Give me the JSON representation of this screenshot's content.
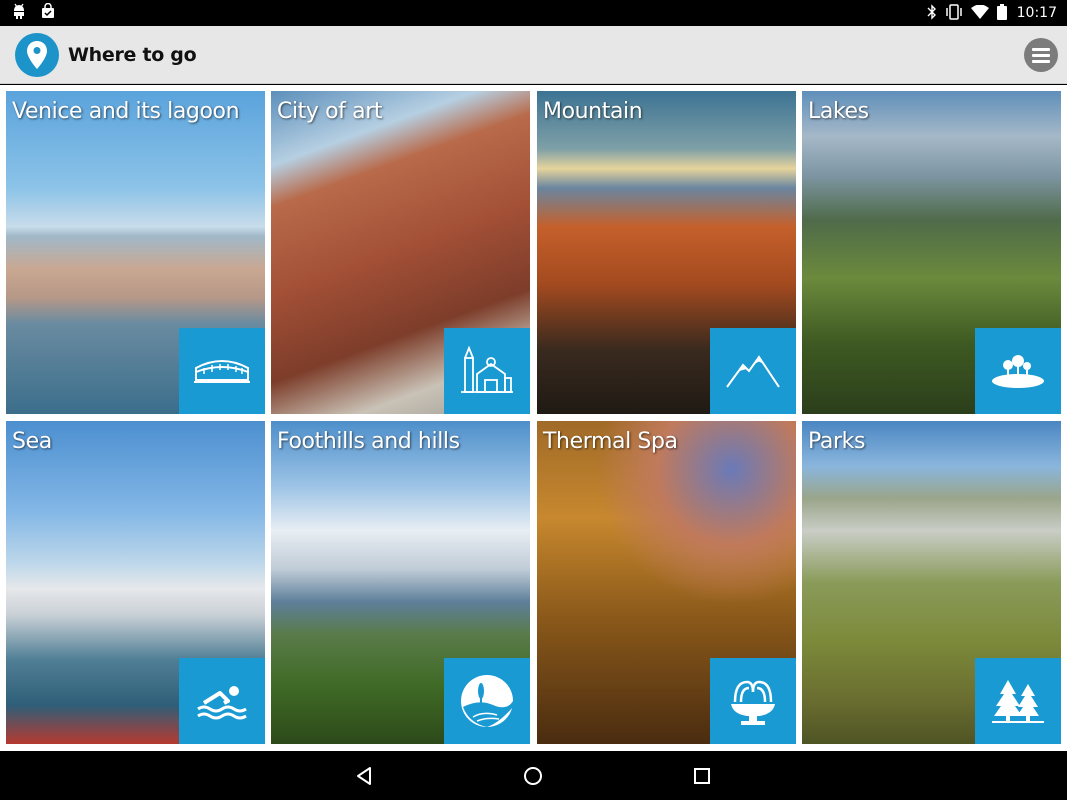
{
  "status_bar": {
    "time": "10:17",
    "left_icons": [
      "android-debug-icon",
      "shopping-bag-icon"
    ],
    "right_icons": [
      "bluetooth-icon",
      "vibrate-icon",
      "wifi-icon",
      "battery-icon"
    ]
  },
  "app_bar": {
    "title": "Where to go",
    "logo_icon": "map-pin-icon",
    "menu_icon": "hamburger-menu-icon"
  },
  "colors": {
    "accent": "#1a9ad3",
    "app_bar_bg": "#e7e7e7",
    "menu_button_bg": "#7c7c7c"
  },
  "tiles": [
    {
      "label": "Venice and its lagoon",
      "icon": "bridge-icon"
    },
    {
      "label": "City of art",
      "icon": "city-buildings-icon"
    },
    {
      "label": "Mountain",
      "icon": "mountain-icon"
    },
    {
      "label": "Lakes",
      "icon": "lake-trees-icon"
    },
    {
      "label": "Sea",
      "icon": "swimmer-icon"
    },
    {
      "label": "Foothills and hills",
      "icon": "hills-icon"
    },
    {
      "label": "Thermal Spa",
      "icon": "fountain-icon"
    },
    {
      "label": "Parks",
      "icon": "pine-trees-icon"
    }
  ],
  "nav_bar": {
    "icons": [
      "back-icon",
      "home-icon",
      "recents-icon"
    ]
  }
}
